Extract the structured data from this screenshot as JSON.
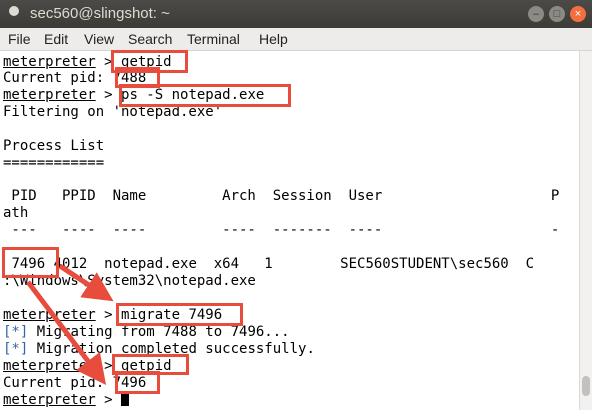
{
  "window": {
    "title": "sec560@slingshot: ~"
  },
  "menu": [
    "File",
    "Edit",
    "View",
    "Search",
    "Terminal",
    "Help"
  ],
  "terminal": {
    "prompt": "meterpreter",
    "sep": " > ",
    "lines": {
      "cmd1": "getpid",
      "pid1_label": "Current pid: ",
      "pid1_value": "7488",
      "cmd2": "ps -S notepad.exe",
      "filter": "Filtering on 'notepad.exe'",
      "plist_title": "Process List",
      "plist_rule": "============",
      "header": " PID   PPID  Name         Arch  Session  User                    P",
      "header_wrap": "ath",
      "dashes": " ---   ----  ----         ----  -------  ----                    -",
      "row_pid": "7496",
      "row_rest": " 4012  notepad.exe  x64   1        SEC560STUDENT\\sec560  C",
      "row_wrap": ":\\Windows\\System32\\notepad.exe",
      "cmd3": "migrate 7496",
      "info_tag": "[*]",
      "info1": " Migrating from 7488 to 7496...",
      "info2": " Migration completed successfully.",
      "cmd4": "getpid",
      "pid2_label": "Current pid: ",
      "pid2_value": "7496"
    }
  },
  "colors": {
    "highlight": "#e84c3d",
    "info": "#3465a4"
  }
}
